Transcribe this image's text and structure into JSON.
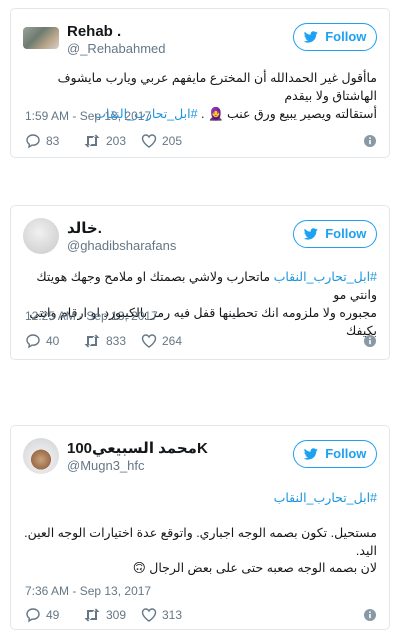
{
  "tweets": [
    {
      "name": "Rehab .",
      "handle": "@_Rehabahmed",
      "follow_label": "Follow",
      "line1": "ماأقول غير الحمدالله أن المخترع مايفهم عربي ويارب مايشوف الهاشتاق ولا بيقدم",
      "line2_tag": "#ابل_تحارب_النقاب",
      "line2_text": "أستقالته ويصير يبيع ورق عنب 🧕 .",
      "time": "1:59 AM - Sep 13, 2017",
      "replies": "83",
      "retweets": "203",
      "likes": "205"
    },
    {
      "name": "خالد.",
      "handle": "@ghadibsharafans",
      "follow_label": "Follow",
      "line1_tag": "#ابل_تحارب_النقاب",
      "line1_text": "ماتحارب ولاشي بصمتك او ملامح وجهك هويتك وانتي مو",
      "line2": "مجبوره ولا ملزومه انك تحطينها قفل فيه رمز بالكيبورد او ارقام وانتي بكيفك",
      "time": "12:25 AM - Sep 13, 2017",
      "replies": "40",
      "retweets": "833",
      "likes": "264"
    },
    {
      "name": "محمد السبيعي100K",
      "handle": "@Mugn3_hfc",
      "follow_label": "Follow",
      "tag": "#ابل_تحارب_النقاب",
      "para1": "مستحيل. تكون بصمه الوجه اجباري. واتوقع عدة اختيارات الوجه العين. اليد.",
      "para2": "لان بصمه الوجه صعبه حتى على بعض الرجال 🙃",
      "time": "7:36 AM - Sep 13, 2017",
      "replies": "49",
      "retweets": "309",
      "likes": "313"
    }
  ],
  "colors": {
    "accent": "#1da1f2",
    "hashtag": "#1b95e0",
    "muted": "#657786",
    "border": "#e1e8ed"
  },
  "icons": [
    "twitter-bird-icon",
    "reply-icon",
    "retweet-icon",
    "heart-icon",
    "info-icon"
  ]
}
